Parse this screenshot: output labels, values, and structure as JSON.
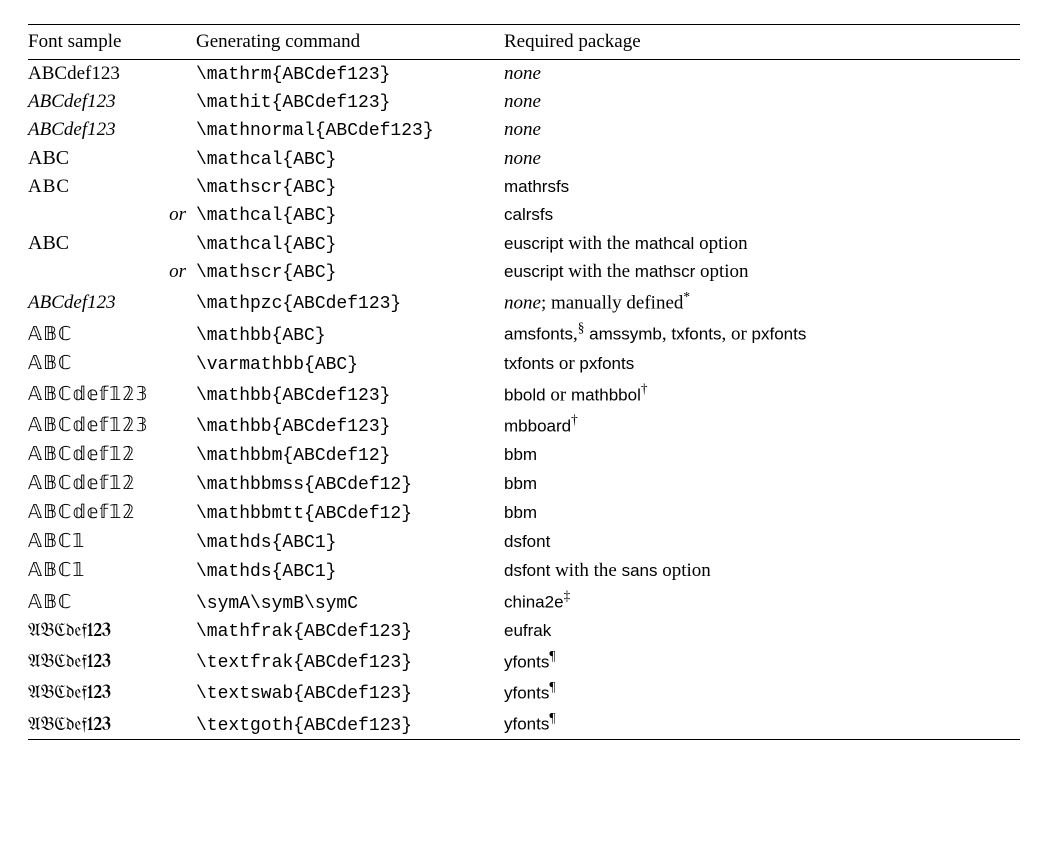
{
  "headers": {
    "sample": "Font sample",
    "cmd": "Generating command",
    "pkg": "Required package"
  },
  "rows": [
    {
      "sample": "ABCdef123",
      "sample_class": "sample-rm",
      "cmd": "\\mathrm{ABCdef123}",
      "pkg": [
        {
          "t": "none",
          "c": "italic"
        }
      ]
    },
    {
      "sample": "ABCdef123",
      "sample_class": "sample-it",
      "cmd": "\\mathit{ABCdef123}",
      "pkg": [
        {
          "t": "none",
          "c": "italic"
        }
      ]
    },
    {
      "sample": "ABCdef123",
      "sample_class": "sample-it",
      "cmd": "\\mathnormal{ABCdef123}",
      "pkg": [
        {
          "t": "none",
          "c": "italic"
        }
      ]
    },
    {
      "sample": "ABC",
      "sample_class": "sample-cal",
      "cmd": "\\mathcal{ABC}",
      "pkg": [
        {
          "t": "none",
          "c": "italic"
        }
      ]
    },
    {
      "sample": "ABC",
      "sample_class": "sample-scr",
      "cmd": "\\mathscr{ABC}",
      "pkg": [
        {
          "t": "mathrsfs",
          "c": "sf"
        }
      ]
    },
    {
      "sample": "or",
      "sample_class": "or-cell",
      "is_or": true,
      "cmd": "\\mathcal{ABC}",
      "pkg": [
        {
          "t": "calrsfs",
          "c": "sf"
        }
      ]
    },
    {
      "sample": "ABC",
      "sample_class": "sample-cal",
      "cmd": "\\mathcal{ABC}",
      "pkg": [
        {
          "t": "euscript",
          "c": "sf"
        },
        {
          "t": " with the ",
          "c": "serif"
        },
        {
          "t": "mathcal",
          "c": "sf"
        },
        {
          "t": " option",
          "c": "serif"
        }
      ]
    },
    {
      "sample": "or",
      "sample_class": "or-cell",
      "is_or": true,
      "cmd": "\\mathscr{ABC}",
      "pkg": [
        {
          "t": "euscript",
          "c": "sf"
        },
        {
          "t": " with the ",
          "c": "serif"
        },
        {
          "t": "mathscr",
          "c": "sf"
        },
        {
          "t": " option",
          "c": "serif"
        }
      ]
    },
    {
      "sample": "ABCdef123",
      "sample_class": "sample-it",
      "cmd": "\\mathpzc{ABCdef123}",
      "pkg": [
        {
          "t": "none",
          "c": "italic"
        },
        {
          "t": "; manually defined",
          "c": "serif"
        }
      ],
      "sup": "*"
    },
    {
      "sample": "𝔸𝔹ℂ",
      "sample_class": "sample-bb",
      "cmd": "\\mathbb{ABC}",
      "pkg": [
        {
          "t": "amsfonts",
          "c": "sf"
        },
        {
          "t": ",",
          "c": "serif"
        },
        {
          "sup": "§"
        },
        {
          "t": " amssymb",
          "c": "sf"
        },
        {
          "t": ", ",
          "c": "serif"
        },
        {
          "t": "txfonts",
          "c": "sf"
        },
        {
          "t": ", or ",
          "c": "serif"
        },
        {
          "t": "pxfonts",
          "c": "sf"
        }
      ]
    },
    {
      "sample": "𝔸𝔹ℂ",
      "sample_class": "sample-bb",
      "cmd": "\\varmathbb{ABC}",
      "pkg": [
        {
          "t": "txfonts",
          "c": "sf"
        },
        {
          "t": " or ",
          "c": "serif"
        },
        {
          "t": "pxfonts",
          "c": "sf"
        }
      ]
    },
    {
      "sample": "𝔸𝔹ℂ𝕕𝕖𝕗𝟙𝟚𝟛",
      "sample_class": "sample-bb",
      "cmd": "\\mathbb{ABCdef123}",
      "pkg": [
        {
          "t": "bbold",
          "c": "sf"
        },
        {
          "t": " or ",
          "c": "serif"
        },
        {
          "t": "mathbbol",
          "c": "sf"
        }
      ],
      "sup": "†"
    },
    {
      "sample": "𝔸𝔹ℂ𝕕𝕖𝕗𝟙𝟚𝟛",
      "sample_class": "sample-bb",
      "cmd": "\\mathbb{ABCdef123}",
      "pkg": [
        {
          "t": "mbboard",
          "c": "sf"
        }
      ],
      "sup": "†"
    },
    {
      "sample": "𝔸𝔹ℂ𝕕𝕖𝕗𝟙𝟚",
      "sample_class": "sample-bb",
      "cmd": "\\mathbbm{ABCdef12}",
      "pkg": [
        {
          "t": "bbm",
          "c": "sf"
        }
      ]
    },
    {
      "sample": "𝔸𝔹ℂ𝕕𝕖𝕗𝟙𝟚",
      "sample_class": "sample-bb",
      "cmd": "\\mathbbmss{ABCdef12}",
      "pkg": [
        {
          "t": "bbm",
          "c": "sf"
        }
      ]
    },
    {
      "sample": "𝔸𝔹ℂ𝕕𝕖𝕗𝟙𝟚",
      "sample_class": "sample-bb",
      "cmd": "\\mathbbmtt{ABCdef12}",
      "pkg": [
        {
          "t": "bbm",
          "c": "sf"
        }
      ]
    },
    {
      "sample": "𝔸𝔹ℂ𝟙",
      "sample_class": "sample-bb",
      "cmd": "\\mathds{ABC1}",
      "pkg": [
        {
          "t": "dsfont",
          "c": "sf"
        }
      ]
    },
    {
      "sample": "𝔸𝔹ℂ𝟙",
      "sample_class": "sample-bb",
      "cmd": "\\mathds{ABC1}",
      "pkg": [
        {
          "t": "dsfont",
          "c": "sf"
        },
        {
          "t": " with the ",
          "c": "serif"
        },
        {
          "t": "sans",
          "c": "sf"
        },
        {
          "t": " option",
          "c": "serif"
        }
      ]
    },
    {
      "sample": "𝔸𝔹ℂ",
      "sample_class": "sample-bb",
      "cmd": "\\symA\\symB\\symC",
      "pkg": [
        {
          "t": "china2e",
          "c": "sf"
        }
      ],
      "sup": "‡"
    },
    {
      "sample": "𝔄𝔅ℭ𝔡𝔢𝔣123",
      "sample_class": "sample-frak",
      "cmd": "\\mathfrak{ABCdef123}",
      "pkg": [
        {
          "t": "eufrak",
          "c": "sf"
        }
      ]
    },
    {
      "sample": "𝔄𝔅ℭ𝔡𝔢𝔣123",
      "sample_class": "sample-frak",
      "cmd": "\\textfrak{ABCdef123}",
      "pkg": [
        {
          "t": "yfonts",
          "c": "sf"
        }
      ],
      "sup": "¶"
    },
    {
      "sample": "𝔄𝔅ℭ𝔡𝔢𝔣123",
      "sample_class": "sample-frak",
      "cmd": "\\textswab{ABCdef123}",
      "pkg": [
        {
          "t": "yfonts",
          "c": "sf"
        }
      ],
      "sup": "¶"
    },
    {
      "sample": "𝔄𝔅ℭ𝔡𝔢𝔣123",
      "sample_class": "sample-frak",
      "cmd": "\\textgoth{ABCdef123}",
      "pkg": [
        {
          "t": "yfonts",
          "c": "sf"
        }
      ],
      "sup": "¶"
    }
  ]
}
